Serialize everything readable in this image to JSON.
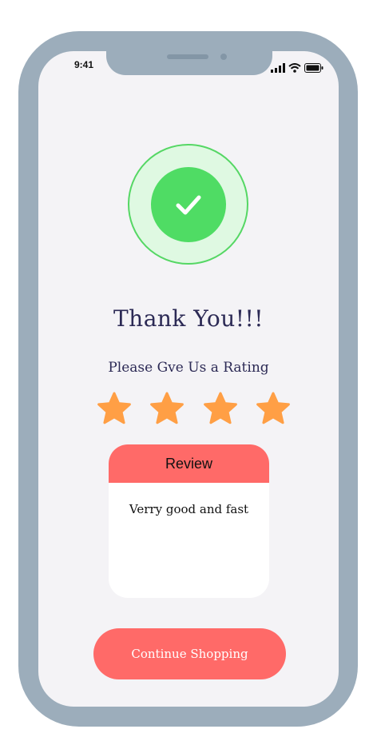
{
  "status_bar": {
    "time": "9:41",
    "icons": [
      "signal-icon",
      "wifi-icon",
      "battery-icon"
    ]
  },
  "success": {
    "icon": "check-icon",
    "badge_color": "#4fdc64",
    "ring_color": "#dff9e2"
  },
  "title": "Thank You!!!",
  "subtitle": "Please Gve Us a Rating",
  "rating": {
    "value": 4,
    "max": 4,
    "star_color": "#ff9f45"
  },
  "review": {
    "heading": "Review",
    "text": "Verry good and fast"
  },
  "continue_button": {
    "label": "Continue Shopping",
    "color": "#ff6a68"
  },
  "colors": {
    "frame": "#9cadbb",
    "screen": "#f4f3f6",
    "text": "#2c2a55"
  }
}
